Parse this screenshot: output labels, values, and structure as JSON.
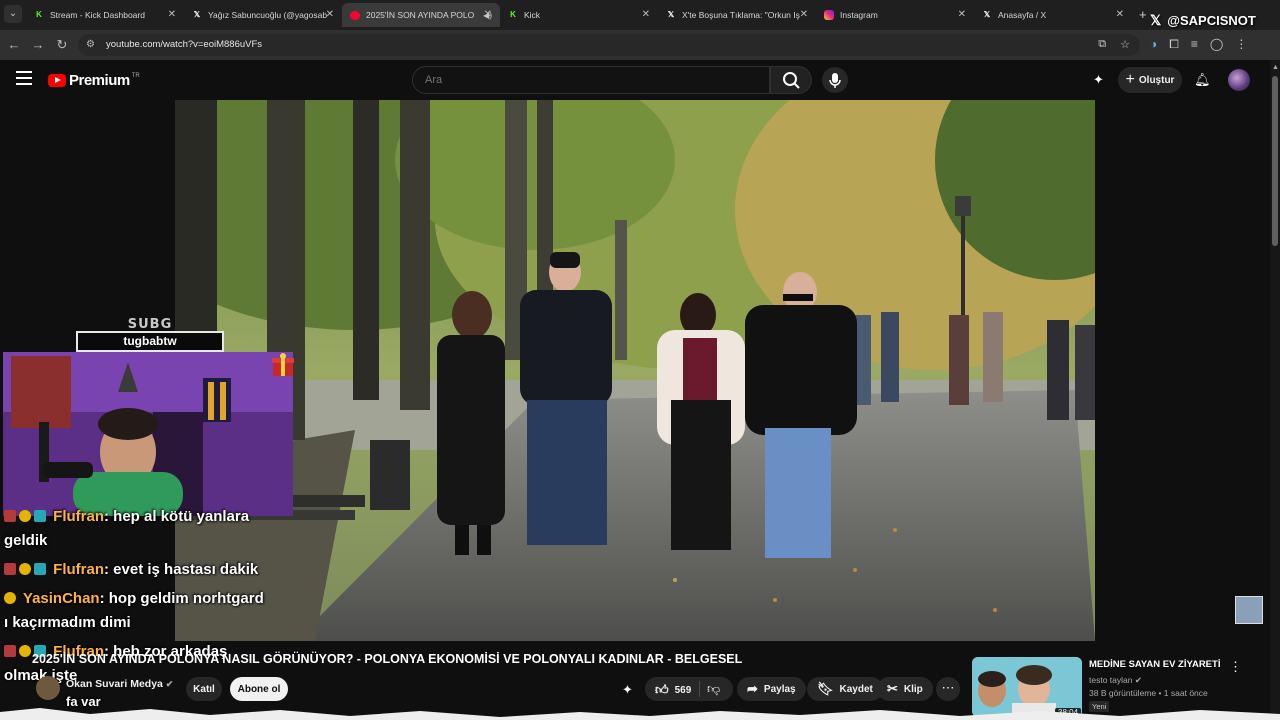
{
  "browser": {
    "tabs": [
      {
        "title": "Stream - Kick Dashboard",
        "icon": "kick-icon"
      },
      {
        "title": "Yağız Sabuncuoğlu (@yagosab",
        "icon": "x-icon"
      },
      {
        "title": "2025'İN SON AYINDA POLO",
        "icon": "youtube-icon",
        "active": true
      },
      {
        "title": "Kick",
        "icon": "kick-icon"
      },
      {
        "title": "X'te Boşuna Tıklama: \"Orkun Iş",
        "icon": "x-icon"
      },
      {
        "title": "Instagram",
        "icon": "instagram-icon"
      },
      {
        "title": "Anasayfa / X",
        "icon": "x-icon"
      }
    ],
    "url": "youtube.com/watch?v=eoiM886uVFs"
  },
  "watermark": {
    "text": "@SAPCISNOT"
  },
  "youtube": {
    "logo_text": "Premium",
    "logo_superscript": "TR",
    "search_placeholder": "Ara",
    "create_label": "Oluştur"
  },
  "overlay": {
    "subg_title": "SUBG",
    "subg_name": "tugbabtw"
  },
  "chat": [
    {
      "user": "Flufran",
      "text": ": hep al kötü yanlara",
      "cont": "geldik"
    },
    {
      "user": "Flufran",
      "text": ": evet iş hastası dakik"
    },
    {
      "user": "YasinChan",
      "text": ": hop geldim norhtgard",
      "cont": "ı kaçırmadım dimi"
    },
    {
      "user": "Flufran",
      "text": ": heb zor arkadaş",
      "cont": "olmak işte"
    }
  ],
  "video": {
    "title": "2025'İN SON AYINDA POLONYA NASIL GÖRÜNÜYOR? - POLONYA EKONOMİSİ VE POLONYALI KADINLAR - BELGESEL",
    "channel": "Okan Suvari Medya",
    "join_label": "Katıl",
    "subscribe_label": "Abone ol",
    "likes": "569",
    "share_label": "Paylaş",
    "save_label": "Kaydet",
    "clip_label": "Klip",
    "partial_chat_bottom": "fa var"
  },
  "recommendation": {
    "title": "MEDİNE SAYAN EV ZİYARETİ",
    "channel": "testo taylan",
    "meta": "38 B görüntüleme • 1 saat önce",
    "badge": "Yeni",
    "duration": "38:04"
  },
  "colors": {
    "yt_red": "#ff0000",
    "chat_user": "#ffb347",
    "bg": "#0f0f0f"
  }
}
